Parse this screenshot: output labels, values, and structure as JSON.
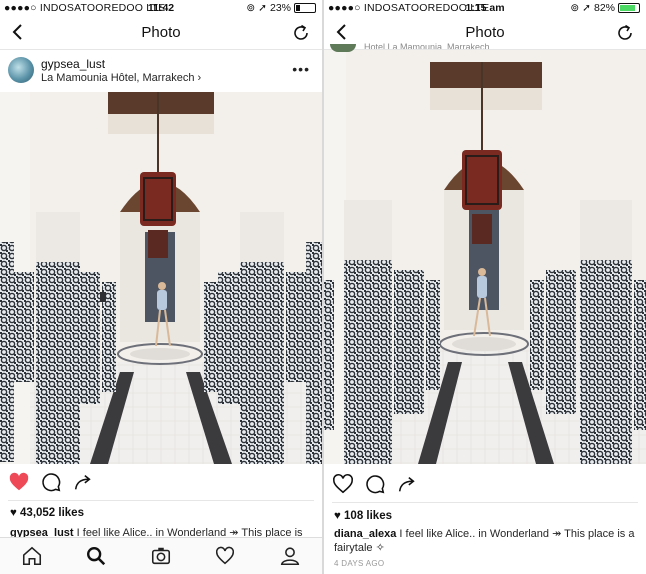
{
  "left": {
    "status": {
      "carrier": "●●●●○ INDOSATOOREDOO  LTE",
      "time": "11:42",
      "battery": "23%",
      "battery_level": 0.23
    },
    "nav": {
      "title": "Photo"
    },
    "post": {
      "username": "gypsea_lust",
      "location": "La Mamounia Hôtel, Marrakech ›",
      "more": "•••"
    },
    "likes": "43,052 likes",
    "caption": {
      "user": "gypsea_lust",
      "text": " I feel like Alice.. in Wonderland ↠ This place is"
    },
    "tabs": [
      "home-icon",
      "search-icon",
      "camera-icon",
      "heart-icon",
      "profile-icon"
    ]
  },
  "right": {
    "status": {
      "carrier": "●●●●○ INDOSATOOREDOO  LTE",
      "time": "1:15 am",
      "battery": "82%",
      "battery_level": 0.82
    },
    "nav": {
      "title": "Photo"
    },
    "hidden_location": "Hotel La Mamounia, Marrakech",
    "likes": "108 likes",
    "caption": {
      "user": "diana_alexa",
      "text": " I feel like Alice.. in Wonderland ↠ This place is a fairytale ✧"
    },
    "time_ago": "4 DAYS AGO"
  },
  "colors": {
    "like_red": "#ed4956",
    "battery_green": "#4cd964"
  }
}
